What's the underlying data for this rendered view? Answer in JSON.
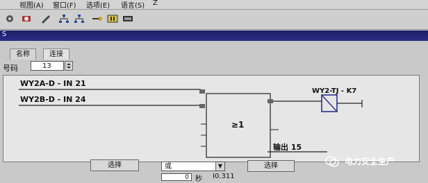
{
  "menu": {
    "items": [
      "视图(A)",
      "窗口(F)",
      "选项(E)",
      "语言(S)",
      "Z"
    ]
  },
  "window": {
    "title": "S"
  },
  "tabs": [
    {
      "label": "名称"
    },
    {
      "label": "连接"
    }
  ],
  "number_field": {
    "label": "号码",
    "value": "13"
  },
  "diagram": {
    "input_labels": [
      "WY2A-D - IN 21",
      "WY2B-D - IN 24"
    ],
    "gate_symbol": "≥1",
    "relay_label": "WY2-TJ - K7",
    "output_label": "输出 15"
  },
  "bottom": {
    "select_left_label": "选择",
    "combo_value": "或",
    "select_right_label": "选择",
    "time_value": "0",
    "time_unit": "秒",
    "status_code": "I0.311"
  },
  "watermark": {
    "text": "电力安全生产"
  },
  "colors": {
    "title_bar": "#1c1e66",
    "canvas_bg": "#e6e6e6",
    "relay_box": "#2b2f88"
  }
}
